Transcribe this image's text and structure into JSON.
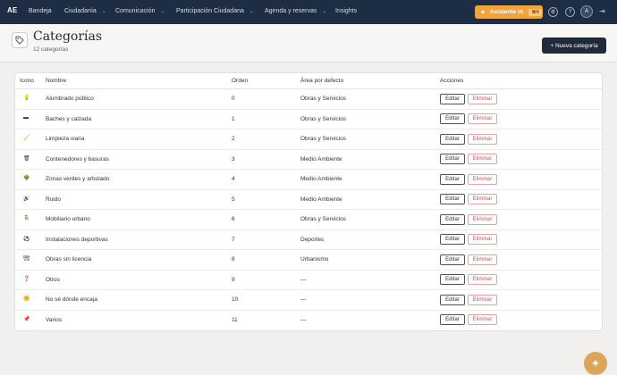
{
  "nav": {
    "logo": "AE",
    "items": [
      {
        "label": "Bandeja",
        "has_menu": false
      },
      {
        "label": "Ciudadanía",
        "has_menu": true
      },
      {
        "label": "Comunicación",
        "has_menu": true
      },
      {
        "label": "Participación Ciudadana",
        "has_menu": true
      },
      {
        "label": "Agenda y reservas",
        "has_menu": true
      },
      {
        "label": "Insights",
        "has_menu": false
      }
    ],
    "assistant_label": "Asistente IA",
    "assistant_badge": "⌘K",
    "avatar_initial": "A",
    "colors": {
      "bar": "#1d2d44",
      "accent": "#f2a33a"
    }
  },
  "header": {
    "title": "Categorías",
    "subtitle": "12 categorías",
    "new_button": "+ Nueva categoría"
  },
  "table": {
    "columns": [
      "Icono",
      "Nombre",
      "Orden",
      "Área por defecto",
      "Acciones"
    ],
    "rows": [
      {
        "icon": "💡",
        "name": "Alumbrado público",
        "order": "0",
        "area": "Obras y Servicios"
      },
      {
        "icon": "▬",
        "name": "Baches y calzada",
        "order": "1",
        "area": "Obras y Servicios"
      },
      {
        "icon": "🧹",
        "name": "Limpieza viaria",
        "order": "2",
        "area": "Obras y Servicios"
      },
      {
        "icon": "🗑",
        "name": "Contenedores y basuras",
        "order": "3",
        "area": "Medio Ambiente"
      },
      {
        "icon": "🌳",
        "name": "Zonas verdes y arbolado",
        "order": "4",
        "area": "Medio Ambiente"
      },
      {
        "icon": "🔊",
        "name": "Ruido",
        "order": "5",
        "area": "Medio Ambiente"
      },
      {
        "icon": "🪑",
        "name": "Mobiliario urbano",
        "order": "6",
        "area": "Obras y Servicios"
      },
      {
        "icon": "⚽",
        "name": "Instalaciones deportivas",
        "order": "7",
        "area": "Deportes"
      },
      {
        "icon": "🏗",
        "name": "Obras sin licencia",
        "order": "8",
        "area": "Urbanismo"
      },
      {
        "icon": "❓",
        "name": "Otros",
        "order": "9",
        "area": "—"
      },
      {
        "icon": "😕",
        "name": "No sé dónde encaja",
        "order": "10",
        "area": "—"
      },
      {
        "icon": "📌",
        "name": "Varios",
        "order": "11",
        "area": "—"
      }
    ],
    "edit_label": "Editar",
    "delete_label": "Eliminar"
  },
  "fab_icon": "sparkle-icon"
}
